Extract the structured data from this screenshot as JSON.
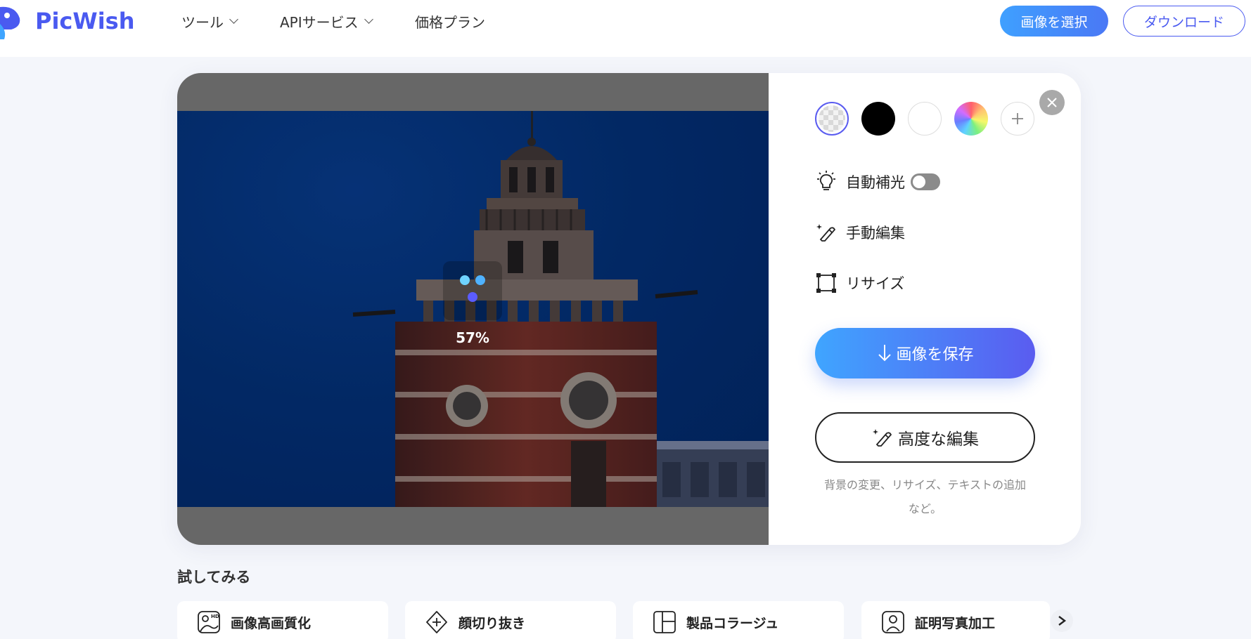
{
  "header": {
    "logo_text": "PicWish",
    "nav": [
      {
        "label": "ツール",
        "has_dropdown": true
      },
      {
        "label": "APIサービス",
        "has_dropdown": true
      },
      {
        "label": "価格プラン",
        "has_dropdown": false
      }
    ],
    "select_image_label": "画像を選択",
    "download_label": "ダウンロード"
  },
  "editor": {
    "progress_text": "57%",
    "background_swatches": [
      {
        "name": "transparent",
        "color": "checkerboard",
        "selected": true
      },
      {
        "name": "black",
        "color": "#000000",
        "selected": false
      },
      {
        "name": "white",
        "color": "#ffffff",
        "selected": false
      },
      {
        "name": "color-wheel",
        "color": "gradient",
        "selected": false
      },
      {
        "name": "add",
        "color": "",
        "selected": false
      }
    ],
    "options": {
      "auto_light": "自動補光",
      "auto_light_enabled": false,
      "manual_edit": "手動編集",
      "resize": "リサイズ"
    },
    "save_label": "画像を保存",
    "advanced_label": "高度な編集",
    "advanced_desc_line1": "背景の変更、リサイズ、テキストの追加",
    "advanced_desc_line2": "など。"
  },
  "try_section": {
    "title": "試してみる",
    "tools": [
      {
        "label": "画像高画質化",
        "icon": "hd-image-icon"
      },
      {
        "label": "顔切り抜き",
        "icon": "face-cutout-icon"
      },
      {
        "label": "製品コラージュ",
        "icon": "collage-icon"
      },
      {
        "label": "証明写真加工",
        "icon": "id-photo-icon"
      }
    ]
  },
  "colors": {
    "brand": "#4a5af0",
    "accent_gradient_start": "#3fa5ff",
    "accent_gradient_end": "#5a5cf0",
    "loader_dot_light": "#6fd3ff",
    "loader_dot_dark": "#5b5cff"
  }
}
